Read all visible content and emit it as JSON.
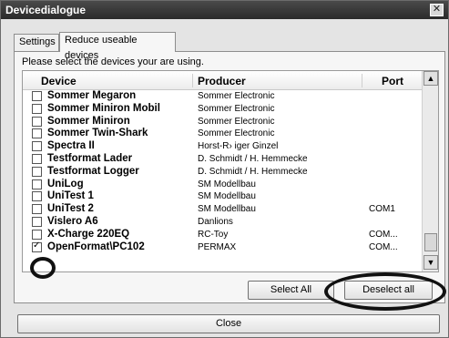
{
  "window": {
    "title": "Devicedialogue",
    "close_glyph": "✕"
  },
  "tabs": [
    {
      "label": "Settings",
      "active": false
    },
    {
      "label": "Reduce useable devices",
      "active": true
    }
  ],
  "panel": {
    "instructions": "Please select the devices your are using."
  },
  "list": {
    "columns": {
      "device": "Device",
      "producer": "Producer",
      "port": "Port"
    },
    "rows": [
      {
        "device": "Sommer Megaron",
        "producer": "Sommer Electronic",
        "port": "",
        "checked": false
      },
      {
        "device": "Sommer Miniron Mobil",
        "producer": "Sommer Electronic",
        "port": "",
        "checked": false
      },
      {
        "device": "Sommer Miniron",
        "producer": "Sommer Electronic",
        "port": "",
        "checked": false
      },
      {
        "device": "Sommer Twin-Shark",
        "producer": "Sommer Electronic",
        "port": "",
        "checked": false
      },
      {
        "device": "Spectra II",
        "producer": "Horst-R› iger Ginzel",
        "port": "",
        "checked": false
      },
      {
        "device": "Testformat Lader",
        "producer": "D. Schmidt / H. Hemmecke",
        "port": "",
        "checked": false
      },
      {
        "device": "Testformat Logger",
        "producer": "D. Schmidt / H. Hemmecke",
        "port": "",
        "checked": false
      },
      {
        "device": "UniLog",
        "producer": "SM Modellbau",
        "port": "",
        "checked": false
      },
      {
        "device": "UniTest 1",
        "producer": "SM Modellbau",
        "port": "",
        "checked": false
      },
      {
        "device": "UniTest 2",
        "producer": "SM Modellbau",
        "port": "COM1",
        "checked": false
      },
      {
        "device": "Vislero A6",
        "producer": "Danlions",
        "port": "",
        "checked": false
      },
      {
        "device": "X-Charge 220EQ",
        "producer": "RC-Toy",
        "port": "COM...",
        "checked": false
      },
      {
        "device": "OpenFormat\\PC102",
        "producer": "PERMAX",
        "port": "COM...",
        "checked": true
      }
    ]
  },
  "buttons": {
    "select_all": "Select All",
    "deselect_all": "Deselect all",
    "close": "Close"
  },
  "icons": {
    "scroll_up": "▲",
    "scroll_down": "▼"
  }
}
